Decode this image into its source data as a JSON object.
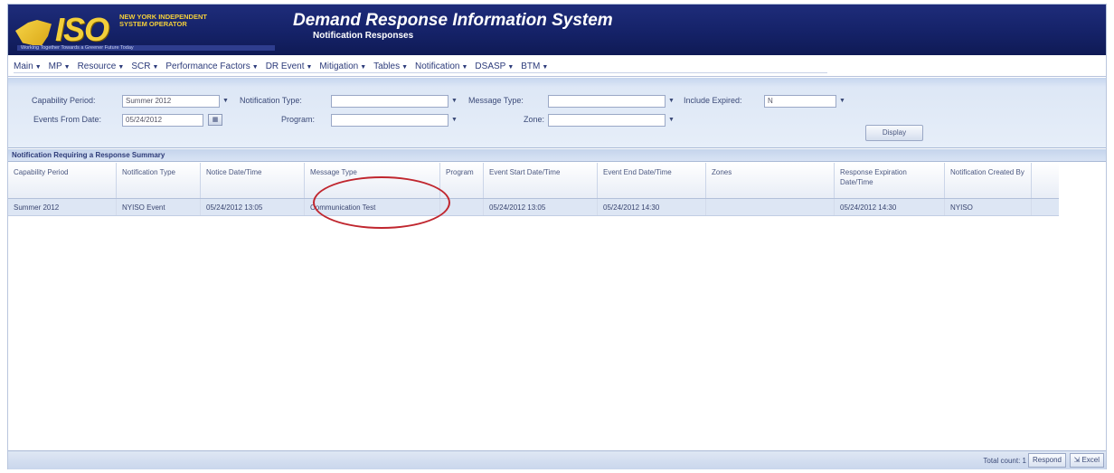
{
  "header": {
    "logo_text": "ISO",
    "company_name": "NEW YORK INDEPENDENT SYSTEM OPERATOR",
    "tagline": "Working Together Towards a Greener Future Today",
    "title": "Demand Response Information System",
    "subtitle": "Notification Responses"
  },
  "menu": {
    "items": [
      {
        "label": "Main"
      },
      {
        "label": "MP"
      },
      {
        "label": "Resource"
      },
      {
        "label": "SCR"
      },
      {
        "label": "Performance Factors"
      },
      {
        "label": "DR Event"
      },
      {
        "label": "Mitigation"
      },
      {
        "label": "Tables"
      },
      {
        "label": "Notification"
      },
      {
        "label": "DSASP"
      },
      {
        "label": "BTM"
      }
    ]
  },
  "filters": {
    "capability_period_label": "Capability Period:",
    "capability_period_value": "Summer 2012",
    "events_from_date_label": "Events From Date:",
    "events_from_date_value": "05/24/2012",
    "notification_type_label": "Notification Type:",
    "notification_type_value": "",
    "program_label": "Program:",
    "program_value": "",
    "message_type_label": "Message Type:",
    "message_type_value": "",
    "zone_label": "Zone:",
    "zone_value": "",
    "include_expired_label": "Include Expired:",
    "include_expired_value": "N",
    "display_button": "Display"
  },
  "section": {
    "title": "Notification Requiring a Response Summary"
  },
  "table": {
    "headers": [
      "Capability Period",
      "Notification Type",
      "Notice Date/Time",
      "Message Type",
      "Program",
      "Event Start Date/Time",
      "Event End Date/Time",
      "Zones",
      "Response Expiration Date/Time",
      "Notification Created By"
    ],
    "rows": [
      [
        "Summer 2012",
        "NYISO Event",
        "05/24/2012 13:05",
        "Communication Test",
        "",
        "05/24/2012 13:05",
        "05/24/2012 14:30",
        "",
        "05/24/2012 14:30",
        "NYISO"
      ]
    ]
  },
  "footer": {
    "total_count": "Total count: 1",
    "respond_button": "Respond",
    "excel_button": "Excel"
  },
  "colors": {
    "header_bg": "#1a2770",
    "logo_yellow": "#f3cf3a",
    "row_bg": "#dde6f4",
    "highlight": "#c0262e"
  }
}
